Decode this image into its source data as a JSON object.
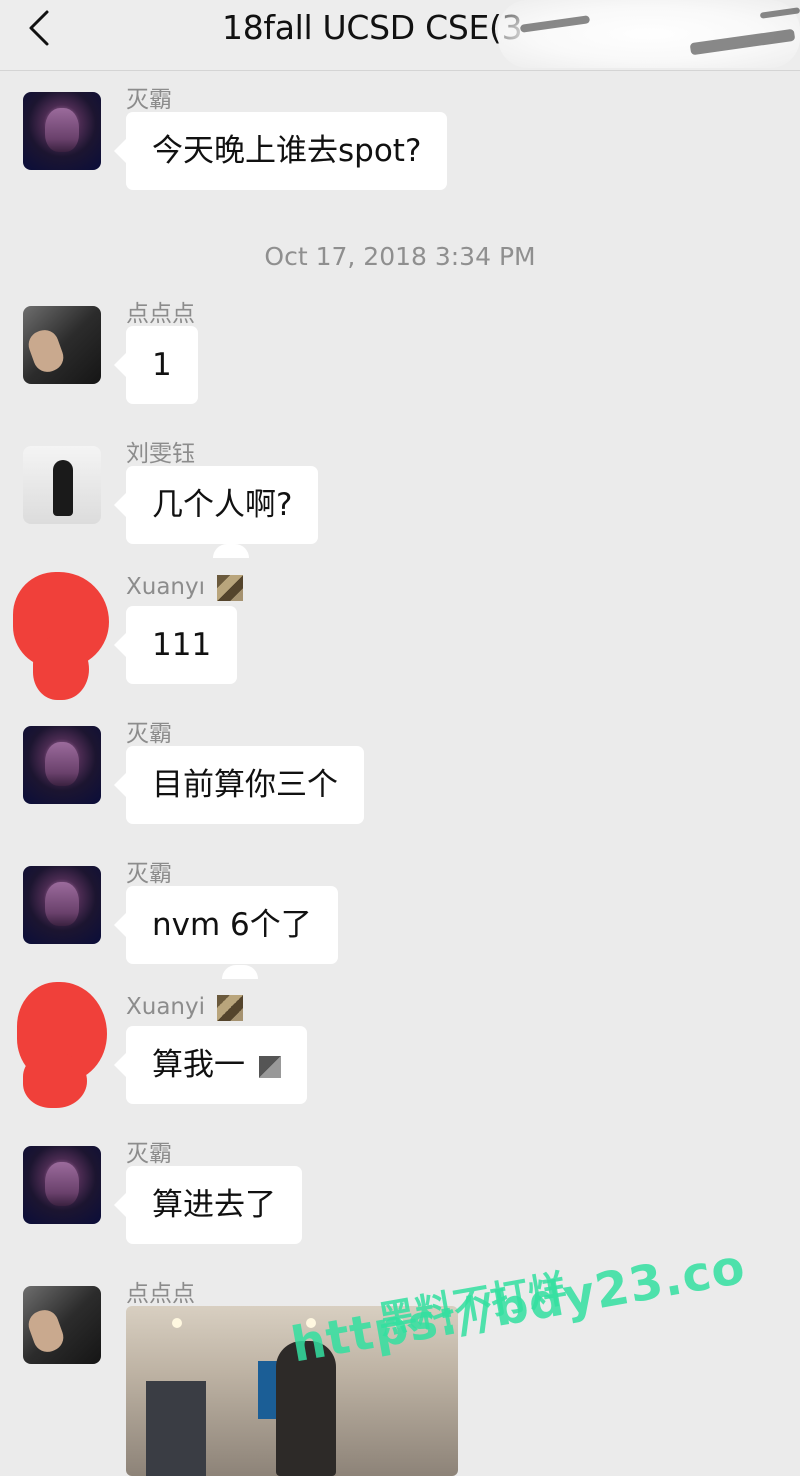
{
  "header": {
    "title": "18fall UCSD CSE(3",
    "back_icon": "chevron-left-icon"
  },
  "timestamp": "Oct 17, 2018 3:34 PM",
  "messages": [
    {
      "sender": "灭霸",
      "text": "今天晚上谁去spot?",
      "avatar": "thanos"
    },
    {
      "sender": "点点点",
      "text": "1",
      "avatar": "hand"
    },
    {
      "sender": "刘雯钰",
      "text": "几个人啊?",
      "avatar": "girl"
    },
    {
      "sender": "Xuanyı",
      "text": "111",
      "avatar": "redacted"
    },
    {
      "sender": "灭霸",
      "text": "目前算你三个",
      "avatar": "thanos"
    },
    {
      "sender": "灭霸",
      "text": "nvm 6个了",
      "avatar": "thanos"
    },
    {
      "sender": "Xuanyi",
      "text": "算我一",
      "avatar": "redacted"
    },
    {
      "sender": "灭霸",
      "text": "算进去了",
      "avatar": "thanos"
    },
    {
      "sender": "点点点",
      "text": "",
      "avatar": "hand",
      "type": "image"
    }
  ],
  "watermark": {
    "line1": "黑料不打烊",
    "line2": "https://bdy23.co",
    "color": "#33e0a0"
  }
}
